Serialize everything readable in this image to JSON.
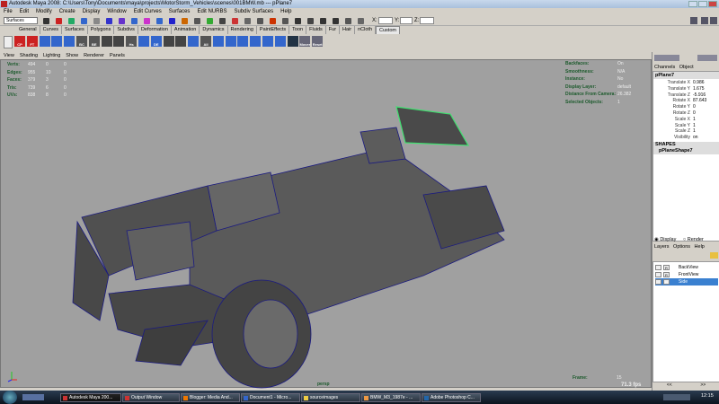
{
  "window": {
    "title": "Autodesk Maya 2008: C:\\Users\\Tony\\Documents\\maya\\projects\\MotorStorm_Vehicles\\scenes\\001BMW.mb  ---  pPlane7"
  },
  "menu": [
    "File",
    "Edit",
    "Modify",
    "Create",
    "Display",
    "Window",
    "Edit Curves",
    "Surfaces",
    "Edit NURBS",
    "Subdiv Surfaces",
    "Help"
  ],
  "toolbar": {
    "mode": "Surfaces",
    "x_label": "X:",
    "y_label": "Y:",
    "z_label": "Z:"
  },
  "shelf_tabs": [
    "General",
    "Curves",
    "Surfaces",
    "Polygons",
    "Subdivs",
    "Deformation",
    "Animation",
    "Dynamics",
    "Rendering",
    "PaintEffects",
    "Toon",
    "Fluids",
    "Fur",
    "Hair",
    "nCloth",
    "Custom"
  ],
  "shelf_active": "Custom",
  "shelf_icons": [
    "CP",
    "FT",
    "",
    "",
    "",
    "BC",
    "BE",
    "",
    "",
    "Hs",
    "",
    "DE",
    "",
    "",
    "",
    "All",
    "",
    "",
    "",
    "",
    "",
    "",
    "",
    "Mover",
    "Reset"
  ],
  "panel_menu": [
    "View",
    "Shading",
    "Lighting",
    "Show",
    "Renderer",
    "Panels"
  ],
  "hud_left": [
    {
      "label": "Verts:",
      "values": [
        "494",
        "0",
        "0"
      ]
    },
    {
      "label": "Edges:",
      "values": [
        "955",
        "10",
        "0"
      ]
    },
    {
      "label": "Faces:",
      "values": [
        "379",
        "3",
        "0"
      ]
    },
    {
      "label": "Tris:",
      "values": [
        "739",
        "6",
        "0"
      ]
    },
    {
      "label": "UVs:",
      "values": [
        "838",
        "8",
        "0"
      ]
    }
  ],
  "hud_right": [
    {
      "label": "Backfaces:",
      "value": "On"
    },
    {
      "label": "Smoothness:",
      "value": "N/A"
    },
    {
      "label": "Instance:",
      "value": "No"
    },
    {
      "label": "Display Layer:",
      "value": "default"
    },
    {
      "label": "Distance From Camera:",
      "value": "26.382"
    },
    {
      "label": "Selected Objects:",
      "value": "1"
    }
  ],
  "camera": "persp",
  "frame": {
    "label": "Frame:",
    "value": "15"
  },
  "fps": "71.3 fps",
  "channel_box": {
    "menus": [
      "Channels",
      "Object"
    ],
    "object": "pPlane7",
    "channels": [
      {
        "name": "Translate X",
        "value": "0.986"
      },
      {
        "name": "Translate Y",
        "value": "1.675"
      },
      {
        "name": "Translate Z",
        "value": "-5.916"
      },
      {
        "name": "Rotate X",
        "value": "87.643"
      },
      {
        "name": "Rotate Y",
        "value": "0"
      },
      {
        "name": "Rotate Z",
        "value": "0"
      },
      {
        "name": "Scale X",
        "value": "1"
      },
      {
        "name": "Scale Y",
        "value": "1"
      },
      {
        "name": "Scale Z",
        "value": "1"
      },
      {
        "name": "Visibility",
        "value": "on"
      }
    ],
    "shapes_header": "SHAPES",
    "shape": "pPlaneShape7"
  },
  "layers": {
    "display": "Display",
    "render": "Render",
    "menus": [
      "Layers",
      "Options",
      "Help"
    ],
    "items": [
      {
        "flag": "R",
        "name": "BackView"
      },
      {
        "flag": "R",
        "name": "FrontView"
      },
      {
        "flag": "R",
        "name": "Side"
      }
    ],
    "selected": "Side",
    "scroll_left": "<<",
    "scroll_right": ">>"
  },
  "taskbar": {
    "tasks": [
      "Autodesk Maya 200...",
      "Output Window",
      "Blogger: Media And...",
      "Document1 - Micro...",
      "sourceimages",
      "BMW_M3_1987e - ...",
      "Adobe Photoshop C..."
    ],
    "clock": "12:15"
  }
}
